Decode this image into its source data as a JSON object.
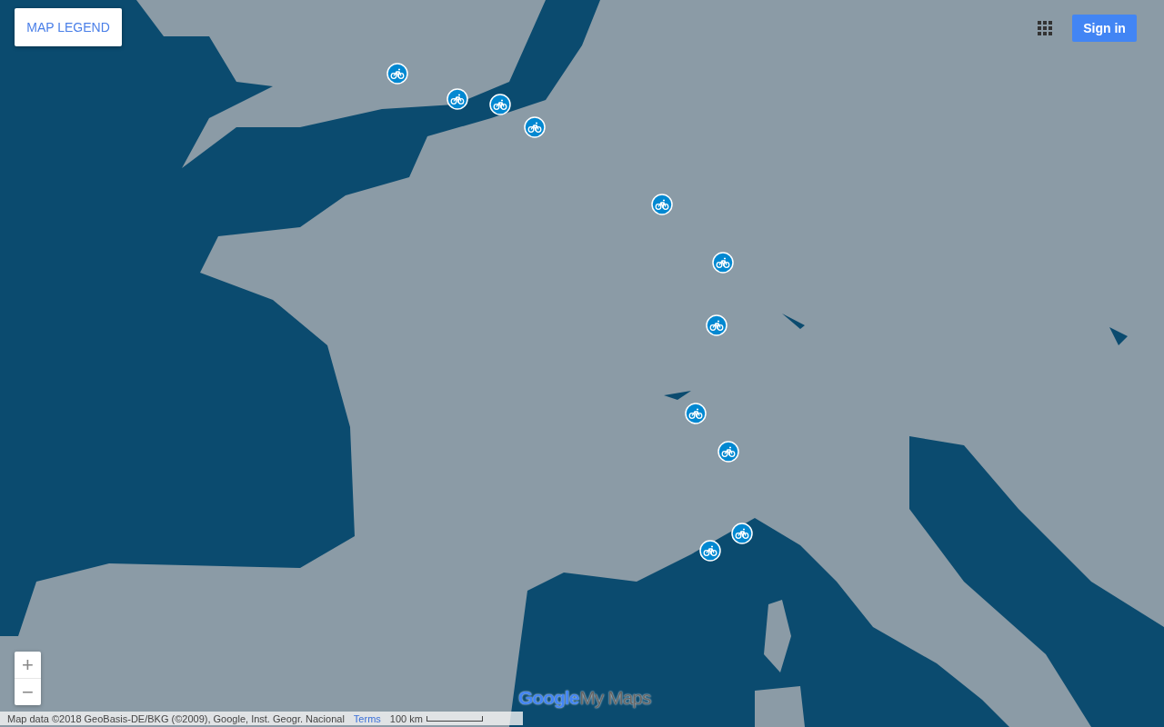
{
  "map_legend_button": "MAP LEGEND",
  "sign_in_button": "Sign in",
  "zoom_controls": {
    "zoom_in": "+",
    "zoom_out": "−"
  },
  "logo": {
    "google": "Google",
    "product": "My Maps"
  },
  "footer": {
    "attribution": "Map data ©2018 GeoBasis-DE/BKG (©2009), Google, Inst. Geogr. Nacional",
    "terms_link": "Terms",
    "scale": "100 km"
  }
}
